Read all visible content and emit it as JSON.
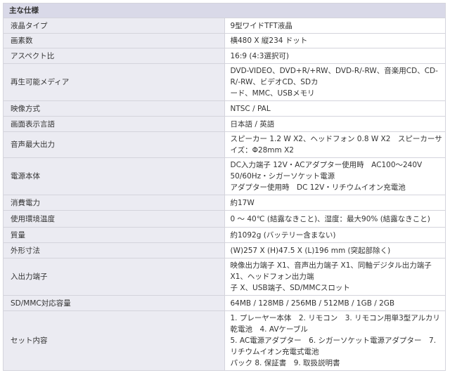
{
  "header": "主な仕様",
  "rows": [
    {
      "label": "液晶タイプ",
      "lines": [
        "9型ワイドTFT液晶"
      ]
    },
    {
      "label": "画素数",
      "lines": [
        "横480 X 縦234 ドット"
      ]
    },
    {
      "label": "アスペクト比",
      "lines": [
        "16:9 (4:3選択可)"
      ]
    },
    {
      "label": "再生可能メディア",
      "lines": [
        "DVD-VIDEO、DVD+R/+RW、DVD-R/-RW、音楽用CD、CD-R/-RW、ビデオCD、SDカ",
        "ード、MMC、USBメモリ"
      ]
    },
    {
      "label": "映像方式",
      "lines": [
        "NTSC / PAL"
      ]
    },
    {
      "label": "画面表示言語",
      "lines": [
        "日本語 / 英語"
      ]
    },
    {
      "label": "音声最大出力",
      "lines": [
        "スピーカー 1.2 W X2、ヘッドフォン 0.8 W X2　スピーカーサイズ：Φ28mm X2"
      ]
    },
    {
      "label": "電源本体",
      "lines": [
        "DC入力端子 12V・ACアダプター使用時　AC100～240V 50/60Hz・シガーソケット電源",
        "アダプター使用時　DC 12V・リチウムイオン充電池"
      ]
    },
    {
      "label": "消費電力",
      "lines": [
        "約17W"
      ]
    },
    {
      "label": "使用環境温度",
      "lines": [
        "0 ～ 40℃ (結露なきこと)、湿度：最大90% (結露なきこと)"
      ]
    },
    {
      "label": "質量",
      "lines": [
        "約1092g (バッテリー含まない)"
      ]
    },
    {
      "label": "外形寸法",
      "lines": [
        "(W)257 X (H)47.5 X (L)196 mm (突起部除く)"
      ]
    },
    {
      "label": "入出力端子",
      "lines": [
        "映像出力端子 X1、音声出力端子 X1、同軸デジタル出力端子 X1、ヘッドフォン出力端",
        "子 X、USB端子、SD/MMCスロット"
      ]
    },
    {
      "label": "SD/MMC対応容量",
      "lines": [
        "64MB / 128MB / 256MB / 512MB / 1GB / 2GB"
      ]
    },
    {
      "label": "セット内容",
      "lines": [
        "1. プレーヤー本体　2. リモコン　3. リモコン用単3型アルカリ乾電池　4. AVケーブル",
        "5. AC電源アダプター　6. シガーソケット電源アダプター　7. リチウムイオン充電式電池",
        "パック 8. 保証書　9. 取扱説明書"
      ]
    }
  ]
}
